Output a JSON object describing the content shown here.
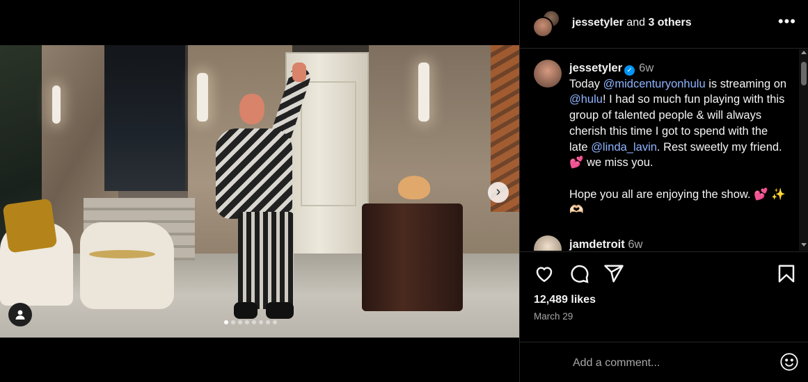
{
  "header": {
    "username": "jessetyler",
    "and_text": " and ",
    "others": "3 others",
    "more_label": "•••"
  },
  "caption": {
    "username": "jessetyler",
    "verified_glyph": "✓",
    "time": "6w",
    "text_1": "Today ",
    "mention_1": "@midcenturyonhulu",
    "text_2": " is streaming on ",
    "mention_2": "@hulu",
    "text_3": "! I had so much fun playing with this group of talented people & will always cherish this time I got to spend with the late ",
    "mention_3": "@linda_lavin",
    "text_4": ". Rest sweetly my friend. 💕  we miss you.",
    "text_5": "Hope you all are enjoying the show. 💕 ✨ 🫶🏻"
  },
  "comment_2": {
    "username": "jamdetroit",
    "time": "6w"
  },
  "media": {
    "next_glyph": "›",
    "dot_count": 8,
    "active_dot": 0
  },
  "stats": {
    "likes": "12,489 likes",
    "date": "March 29"
  },
  "add_comment": {
    "placeholder": "Add a comment..."
  },
  "icons": {
    "like": "heart-icon",
    "comment": "comment-icon",
    "share": "share-icon",
    "save": "bookmark-icon",
    "emoji": "emoji-icon",
    "user_tag": "user-icon"
  }
}
